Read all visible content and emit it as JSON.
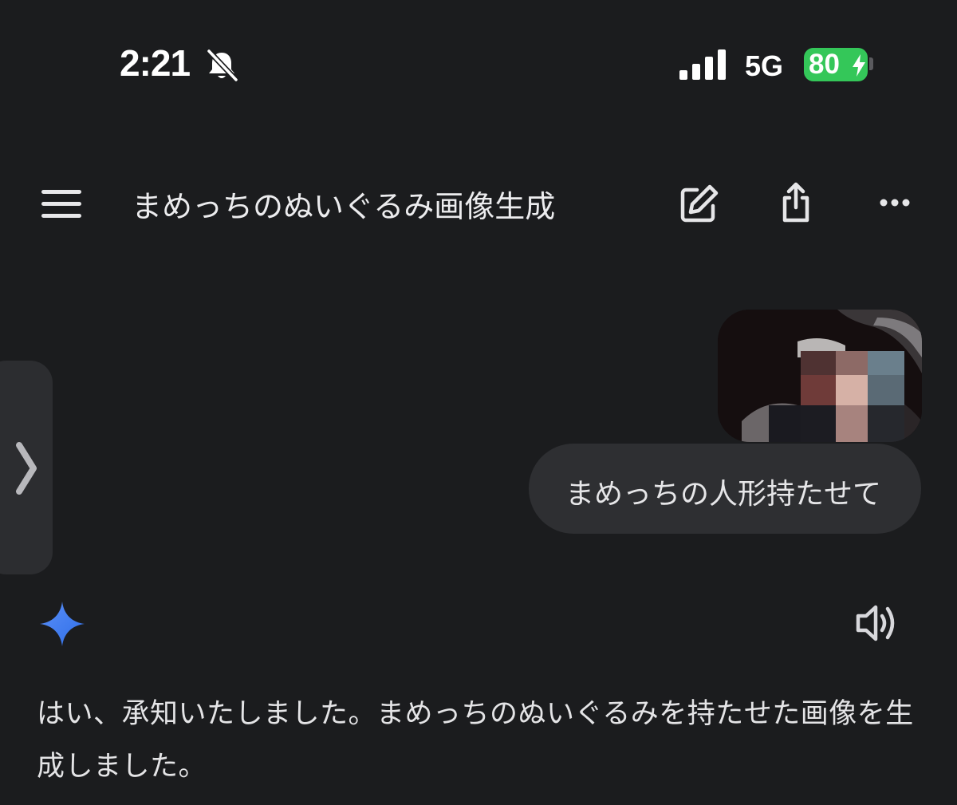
{
  "status_bar": {
    "time": "2:21",
    "network": "5G",
    "battery_percent": "80",
    "battery_color": "#34c759",
    "icons": [
      "bell-off-icon",
      "signal-icon",
      "battery-icon",
      "charging-bolt-icon"
    ]
  },
  "app_bar": {
    "menu_icon": "hamburger-menu-icon",
    "title": "まめっちのぬいぐるみ画像生成",
    "edit_icon": "edit-icon",
    "share_icon": "share-icon",
    "more_icon": "more-horizontal-icon"
  },
  "drawer_handle": {
    "icon": "chevron-right-icon"
  },
  "conversation": {
    "user_message": {
      "attachment": "pixelated-photo",
      "text": "まめっちの人形持たせて"
    },
    "assistant_message": {
      "avatar_icon": "gemini-sparkle-icon",
      "sparkle_color": "#3d7ef5",
      "read_aloud_icon": "speaker-icon",
      "text": "はい、承知いたしました。まめっちのぬいぐるみを持たせた画像を生成しました。"
    }
  }
}
